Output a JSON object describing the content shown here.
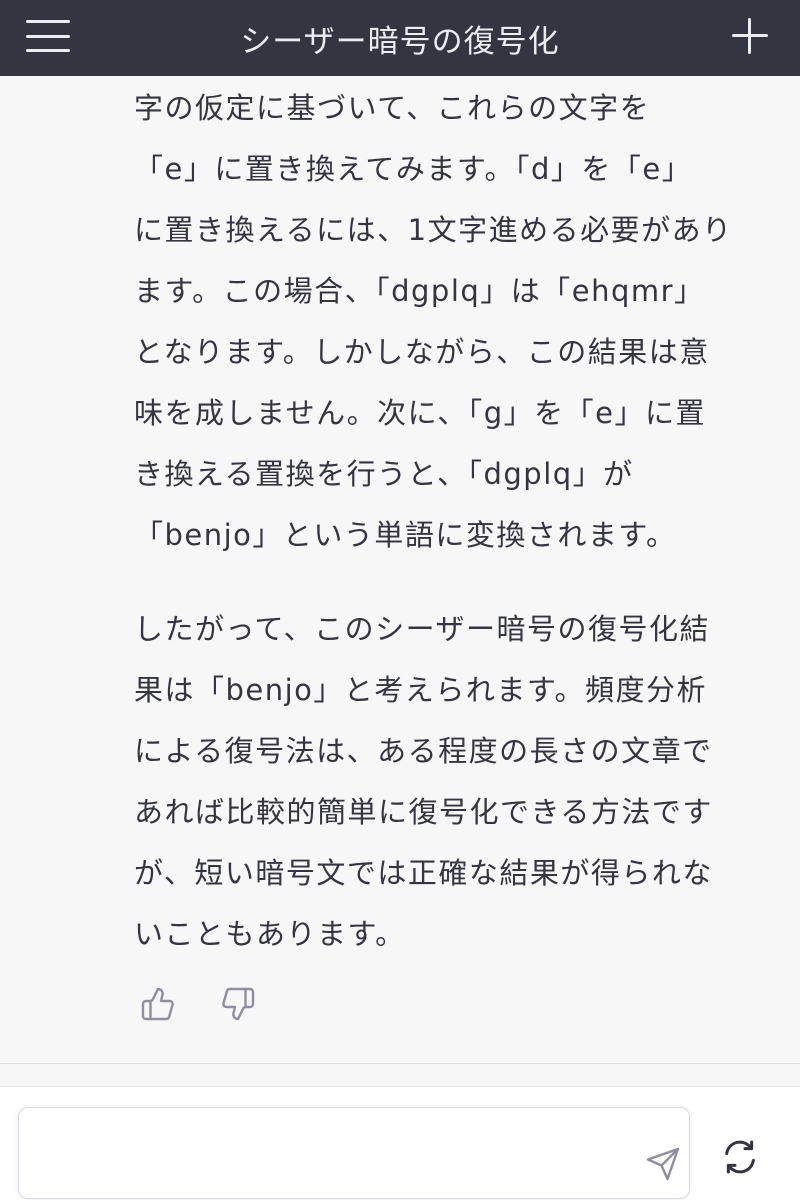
{
  "header": {
    "title": "シーザー暗号の復号化",
    "menu_icon": "hamburger-menu-icon",
    "new_chat_icon": "plus-icon"
  },
  "message": {
    "paragraph1": [
      "字の仮定に基づいて、これらの文字を",
      "「e」に置き換えてみます。「d」を「e」",
      "に置き換えるには、1文字進める必要があり",
      "ます。この場合、「dgplq」は「ehqmr」",
      "となります。しかしながら、この結果は意",
      "味を成しません。次に、「g」を「e」に置",
      "き換える置換を行うと、「dgplq」が",
      "「benjo」という単語に変換されます。"
    ],
    "paragraph2": [
      "したがって、このシーザー暗号の復号化結",
      "果は「benjo」と考えられます。頻度分析",
      "による復号法は、ある程度の長さの文章で",
      "あれば比較的簡単に復号化できる方法です",
      "が、短い暗号文では正確な結果が得られな",
      "いこともあります。"
    ]
  },
  "feedback": {
    "like_icon": "thumbs-up-icon",
    "dislike_icon": "thumbs-down-icon"
  },
  "composer": {
    "input_value": "",
    "placeholder": "",
    "send_icon": "send-icon",
    "regenerate_icon": "regenerate-icon"
  },
  "colors": {
    "header_bg": "#343541",
    "page_bg": "#f7f7f8",
    "text": "#343541",
    "icon_gray": "#8e8ea0"
  }
}
